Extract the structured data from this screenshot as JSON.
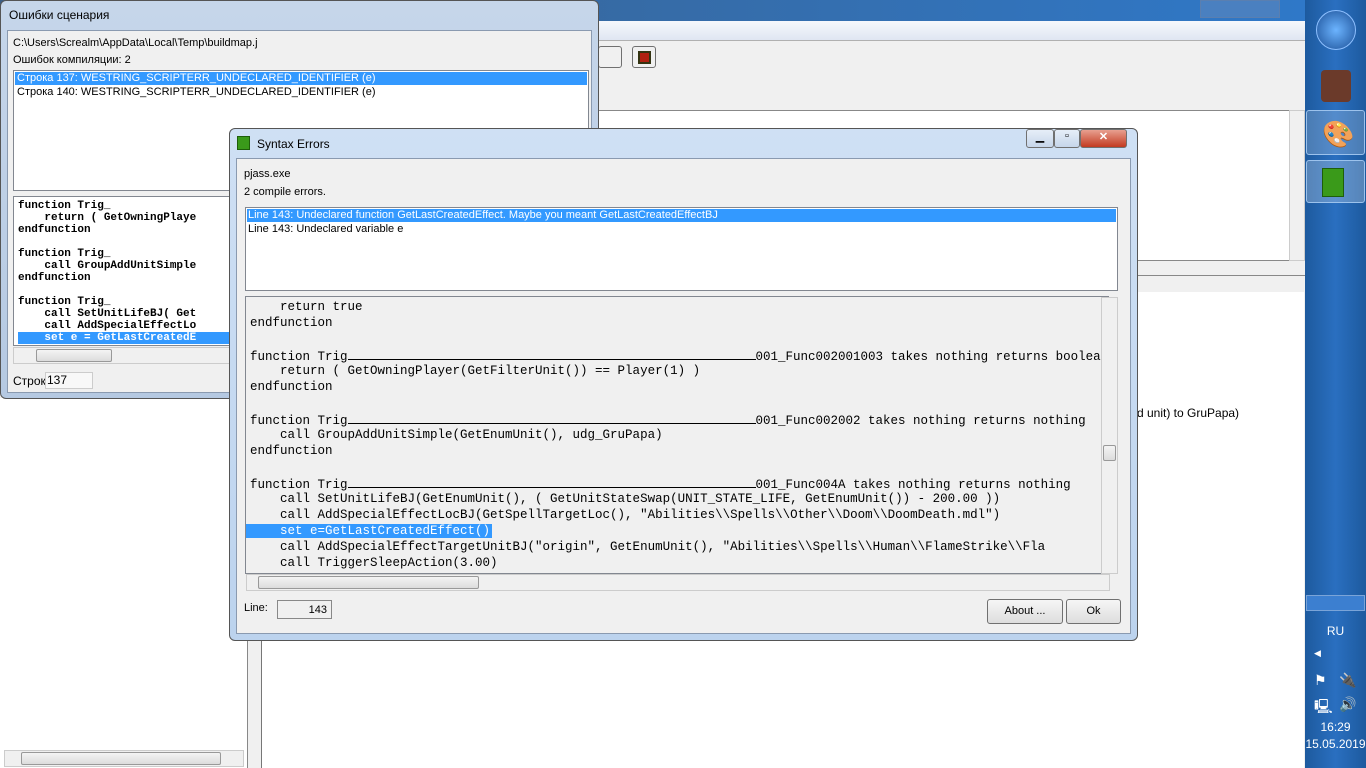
{
  "taskbar": {
    "lang": "RU",
    "time": "16:29",
    "date": "15.05.2019"
  },
  "main": {
    "right_text": "d unit) to GruPapa)"
  },
  "script_errors": {
    "title": "Ошибки сценария",
    "path": "C:\\Users\\Screalm\\AppData\\Local\\Temp\\buildmap.j",
    "count": "Ошибок компиляции: 2",
    "errors": [
      "Строка 137: WESTRING_SCRIPTERR_UNDECLARED_IDENTIFIER (e)",
      "Строка 140: WESTRING_SCRIPTERR_UNDECLARED_IDENTIFIER (e)"
    ],
    "code": [
      "function Trig_",
      "    return ( GetOwningPlaye",
      "endfunction",
      "",
      "function Trig_",
      "    call GroupAddUnitSimple",
      "endfunction",
      "",
      "function Trig_",
      "    call SetUnitLifeBJ( Get",
      "    call AddSpecialEffectLo",
      "    set e = GetLastCreatedE"
    ],
    "line_label": "Строк",
    "line_value": "137"
  },
  "syntax_errors": {
    "title": "Syntax Errors",
    "exe": "pjass.exe",
    "count": "2 compile errors.",
    "errors": [
      "Line 143:  Undeclared function GetLastCreatedEffect. Maybe you meant GetLastCreatedEffectBJ",
      "Line 143:  Undeclared variable e"
    ],
    "code": [
      "    return true",
      "endfunction",
      "",
      "function Trig",
      "    return ( GetOwningPlayer(GetFilterUnit()) == Player(1) )",
      "endfunction",
      "",
      "function Trig",
      "    call GroupAddUnitSimple(GetEnumUnit(), udg_GruPapa)",
      "endfunction",
      "",
      "function Trig",
      "    call SetUnitLifeBJ(GetEnumUnit(), ( GetUnitStateSwap(UNIT_STATE_LIFE, GetEnumUnit()) - 200.00 ))",
      "    call AddSpecialEffectLocBJ(GetSpellTargetLoc(), \"Abilities\\\\Spells\\\\Other\\\\Doom\\\\DoomDeath.mdl\")",
      "    set e=GetLastCreatedEffect()",
      "    call AddSpecialEffectTargetUnitBJ(\"origin\", GetEnumUnit(), \"Abilities\\\\Spells\\\\Human\\\\FlameStrike\\\\Fla",
      "    call TriggerSleepAction(3.00)"
    ],
    "suffixes": {
      "3": "001_Func002001003 takes nothing returns boolean",
      "7": "001_Func002002 takes nothing returns nothing",
      "11": "001_Func004A takes nothing returns nothing"
    },
    "selected_line": 14,
    "line_label": "Line:",
    "line_value": "143",
    "about": "About ...",
    "ok": "Ok"
  }
}
